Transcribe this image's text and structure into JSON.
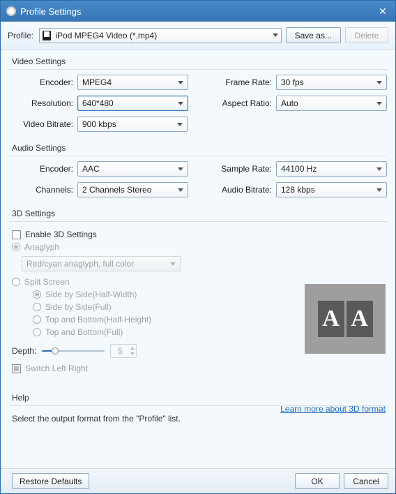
{
  "window": {
    "title": "Profile Settings"
  },
  "profile": {
    "label": "Profile:",
    "selected": "iPod MPEG4 Video (*.mp4)",
    "saveAsLabel": "Save as...",
    "deleteLabel": "Delete"
  },
  "video": {
    "groupTitle": "Video Settings",
    "encoder": {
      "label": "Encoder:",
      "value": "MPEG4"
    },
    "resolution": {
      "label": "Resolution:",
      "value": "640*480"
    },
    "bitrate": {
      "label": "Video Bitrate:",
      "value": "900 kbps"
    },
    "frameRate": {
      "label": "Frame Rate:",
      "value": "30 fps"
    },
    "aspectRatio": {
      "label": "Aspect Ratio:",
      "value": "Auto"
    }
  },
  "audio": {
    "groupTitle": "Audio Settings",
    "encoder": {
      "label": "Encoder:",
      "value": "AAC"
    },
    "channels": {
      "label": "Channels:",
      "value": "2 Channels Stereo"
    },
    "sampleRate": {
      "label": "Sample Rate:",
      "value": "44100 Hz"
    },
    "bitrate": {
      "label": "Audio Bitrate:",
      "value": "128 kbps"
    }
  },
  "threeD": {
    "groupTitle": "3D Settings",
    "enableLabel": "Enable 3D Settings",
    "anaglyphLabel": "Anaglyph",
    "anaglyphOption": "Red/cyan anaglyph, full color",
    "splitScreenLabel": "Split Screen",
    "optSideHalf": "Side by Side(Half-Width)",
    "optSideFull": "Side by Side(Full)",
    "optTBHalf": "Top and Bottom(Half-Height)",
    "optTBFull": "Top and Bottom(Full)",
    "depthLabel": "Depth:",
    "depthValue": "5",
    "switchLabel": "Switch Left Right",
    "linkLabel": "Learn more about 3D format",
    "previewLetter": "A"
  },
  "help": {
    "groupTitle": "Help",
    "text": "Select the output format from the \"Profile\" list."
  },
  "footer": {
    "restore": "Restore Defaults",
    "ok": "OK",
    "cancel": "Cancel"
  }
}
